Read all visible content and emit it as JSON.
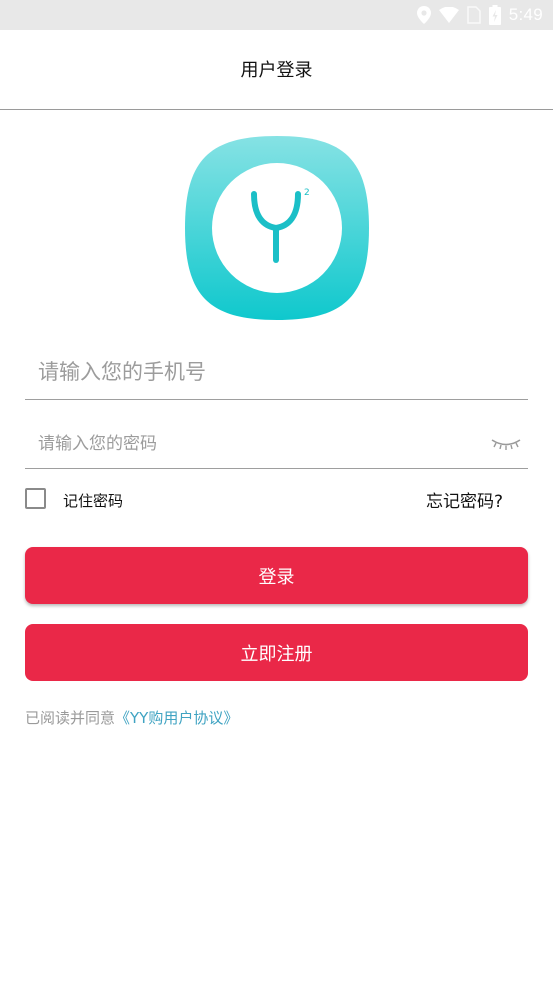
{
  "status_bar": {
    "time": "5:49",
    "icons": [
      "location-icon",
      "wifi-icon",
      "sim-icon",
      "battery-icon"
    ]
  },
  "header": {
    "title": "用户登录"
  },
  "logo": {
    "name": "yy-app-logo",
    "mark": "Y",
    "superscript": "2",
    "colors": {
      "gradient_top": "#86e2e4",
      "gradient_bottom": "#0fc8cd",
      "inner": "#ffffff",
      "mark": "#1bbfc7"
    }
  },
  "form": {
    "phone_placeholder": "请输入您的手机号",
    "phone_value": "",
    "password_placeholder": "请输入您的密码",
    "password_value": "",
    "password_toggle_icon": "eye-closed-icon",
    "remember_label": "记住密码",
    "remember_checked": false,
    "forgot_label": "忘记密码?"
  },
  "buttons": {
    "login_label": "登录",
    "register_label": "立即注册",
    "color": "#ea2848"
  },
  "agreement": {
    "prefix": "已阅读并同意",
    "link": "《YY购用户协议》",
    "link_color": "#3fa3c2"
  }
}
